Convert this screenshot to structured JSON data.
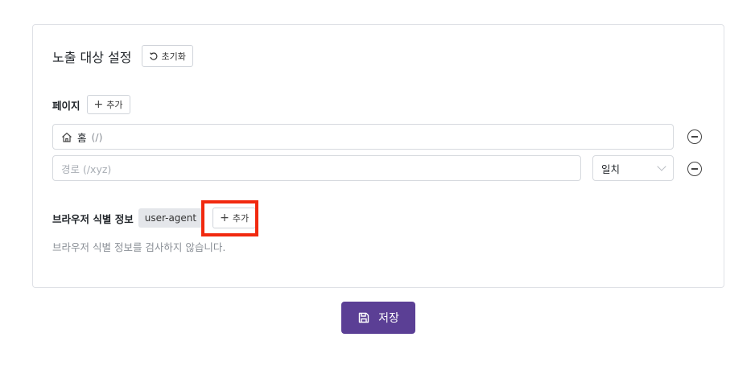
{
  "card": {
    "title": "노출 대상 설정",
    "reset_label": "초기화"
  },
  "pages": {
    "label": "페이지",
    "add_label": "추가",
    "home_row": {
      "name": "홈",
      "path": "(/)"
    },
    "path_input": {
      "placeholder": "경로 (/xyz)",
      "match_value": "일치"
    }
  },
  "browser": {
    "label": "브라우저 식별 정보",
    "tag": "user-agent",
    "add_label": "추가",
    "hint": "브라우저 식별 정보를 검사하지 않습니다."
  },
  "footer": {
    "save_label": "저장"
  },
  "colors": {
    "primary": "#5b3f95",
    "highlight": "#f1290f"
  },
  "icons": {
    "reset": "rotate-ccw-icon",
    "plus": "plus-icon",
    "home": "home-icon",
    "remove": "minus-circle-icon",
    "chevron": "chevron-down-icon",
    "save": "floppy-disk-icon"
  }
}
